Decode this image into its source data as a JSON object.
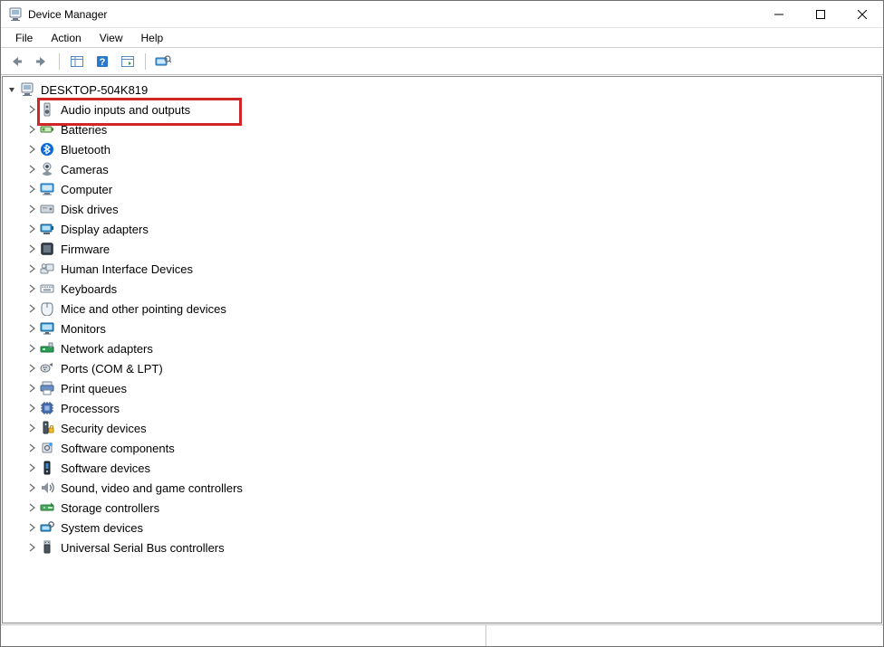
{
  "title": "Device Manager",
  "menus": {
    "file": "File",
    "action": "Action",
    "view": "View",
    "help": "Help"
  },
  "toolbar": {
    "back": "back",
    "forward": "forward",
    "show_hide": "show-hide-console-tree",
    "help_btn": "help",
    "action_btn": "action",
    "scan": "scan-for-hardware-changes"
  },
  "root": {
    "label": "DESKTOP-504K819",
    "icon": "computer-root-icon"
  },
  "categories": [
    {
      "label": "Audio inputs and outputs",
      "icon": "speaker-icon",
      "highlight": true
    },
    {
      "label": "Batteries",
      "icon": "battery-icon"
    },
    {
      "label": "Bluetooth",
      "icon": "bluetooth-icon"
    },
    {
      "label": "Cameras",
      "icon": "camera-icon"
    },
    {
      "label": "Computer",
      "icon": "computer-icon"
    },
    {
      "label": "Disk drives",
      "icon": "disk-drive-icon"
    },
    {
      "label": "Display adapters",
      "icon": "display-adapter-icon"
    },
    {
      "label": "Firmware",
      "icon": "firmware-icon"
    },
    {
      "label": "Human Interface Devices",
      "icon": "hid-icon"
    },
    {
      "label": "Keyboards",
      "icon": "keyboard-icon"
    },
    {
      "label": "Mice and other pointing devices",
      "icon": "mouse-icon"
    },
    {
      "label": "Monitors",
      "icon": "monitor-icon"
    },
    {
      "label": "Network adapters",
      "icon": "network-adapter-icon"
    },
    {
      "label": "Ports (COM & LPT)",
      "icon": "port-icon"
    },
    {
      "label": "Print queues",
      "icon": "printer-icon"
    },
    {
      "label": "Processors",
      "icon": "processor-icon"
    },
    {
      "label": "Security devices",
      "icon": "security-device-icon"
    },
    {
      "label": "Software components",
      "icon": "software-component-icon"
    },
    {
      "label": "Software devices",
      "icon": "software-device-icon"
    },
    {
      "label": "Sound, video and game controllers",
      "icon": "sound-controller-icon"
    },
    {
      "label": "Storage controllers",
      "icon": "storage-controller-icon"
    },
    {
      "label": "System devices",
      "icon": "system-device-icon"
    },
    {
      "label": "Universal Serial Bus controllers",
      "icon": "usb-icon"
    }
  ]
}
